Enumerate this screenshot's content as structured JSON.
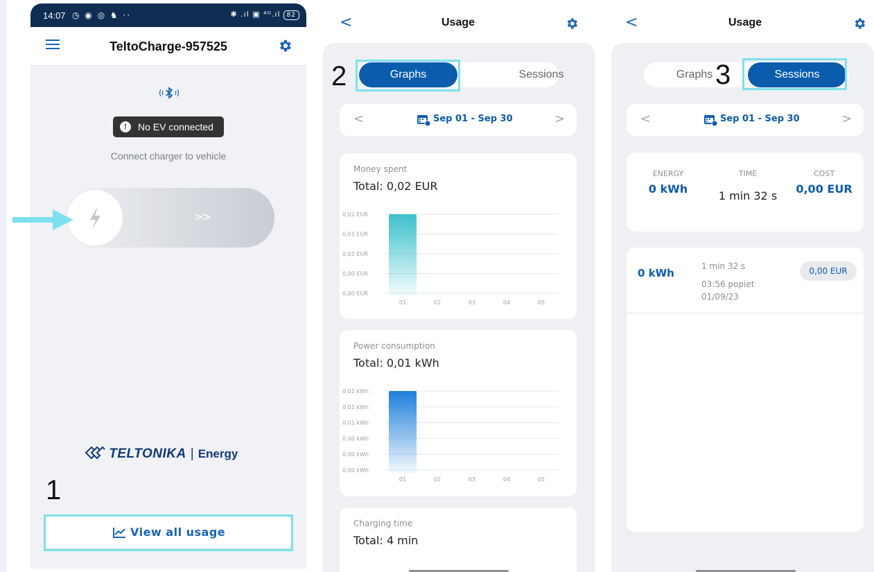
{
  "colors": {
    "primary": "#0b5cad",
    "highlight": "#7ee0ee",
    "status_bar": "#0f2d52",
    "panel_bg": "#eff0f3"
  },
  "phone1": {
    "status_bar": {
      "time": "14:07",
      "left_icons": "◷ ◉ ◎ ♞ ··",
      "right_icons": "✱ .ıl ▣ ⁴ᴳ.ıl",
      "battery": "82"
    },
    "header": {
      "menu_icon": "hamburger-icon",
      "title": "TeltoCharge-957525",
      "settings_icon": "gear-icon"
    },
    "bluetooth_icon": "bluetooth-signal-icon",
    "status_badge": "No EV connected",
    "hint": "Connect charger to vehicle",
    "slider": {
      "knob_icon": "lightning-icon",
      "chevrons": ">>"
    },
    "logo": {
      "brand": "TELTONIKA",
      "separator": "|",
      "product": "Energy"
    },
    "view_all_button": "View all usage",
    "annotation": "1"
  },
  "phone2": {
    "header": {
      "back": "<",
      "title": "Usage",
      "settings_icon": "gear-icon"
    },
    "tabs": {
      "graphs": "Graphs",
      "sessions": "Sessions",
      "active": "Graphs"
    },
    "annotation": "2",
    "date_range": {
      "prev": "<",
      "label": "Sep 01 - Sep 30",
      "next": ">"
    },
    "cards": [
      {
        "title": "Money spent",
        "total": "Total: 0,02 EUR"
      },
      {
        "title": "Power consumption",
        "total": "Total: 0,01 kWh"
      },
      {
        "title": "Charging time",
        "total": "Total: 4 min"
      }
    ]
  },
  "phone3": {
    "header": {
      "back": "<",
      "title": "Usage",
      "settings_icon": "gear-icon"
    },
    "tabs": {
      "graphs": "Graphs",
      "sessions": "Sessions",
      "active": "Sessions"
    },
    "annotation": "3",
    "date_range": {
      "prev": "<",
      "label": "Sep 01 - Sep 30",
      "next": ">"
    },
    "summary": {
      "energy": {
        "label": "ENERGY",
        "value": "0 kWh"
      },
      "time": {
        "label": "TIME",
        "value": "1 min 32 s"
      },
      "cost": {
        "label": "COST",
        "value": "0,00 EUR"
      }
    },
    "sessions": [
      {
        "energy": "0 kWh",
        "duration": "1 min 32 s",
        "clock": "03:56 popiet",
        "date": "01/09/23",
        "cost": "0,00 EUR"
      }
    ]
  },
  "chart_data": [
    {
      "type": "bar",
      "title": "Money spent",
      "categories": [
        "01",
        "02",
        "03",
        "04",
        "05"
      ],
      "values": [
        0.02,
        0,
        0,
        0,
        0
      ],
      "y_tick_labels": [
        "0,02 EUR",
        "0,01 EUR",
        "0,01 EUR",
        "0,00 EUR",
        "0,00 EUR"
      ],
      "ylim": [
        0,
        0.02
      ],
      "color": "#3cc0cc",
      "grid": true
    },
    {
      "type": "bar",
      "title": "Power consumption",
      "categories": [
        "01",
        "02",
        "03",
        "04",
        "05"
      ],
      "values": [
        0.01,
        0,
        0,
        0,
        0
      ],
      "y_tick_labels": [
        "0,01 kWh",
        "0,01 kWh",
        "0,01 kWh",
        "0,00 kWh",
        "0,00 kWh",
        "0,00 kWh"
      ],
      "ylim": [
        0,
        0.01
      ],
      "color": "#1f7fdc",
      "grid": true
    }
  ]
}
